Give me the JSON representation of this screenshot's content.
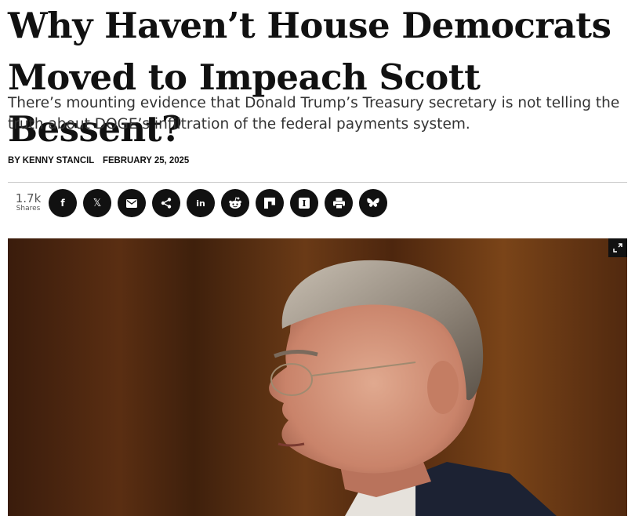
{
  "article": {
    "headline": "Why Haven’t House Democrats Moved to Impeach Scott Bessent?",
    "dek": "There’s mounting evidence that Donald Trump’s Treasury secretary is not telling the truth about DOGE’s infiltration of the federal payments system.",
    "byline": "BY KENNY STANCIL",
    "date": "FEBRUARY 25, 2025"
  },
  "share": {
    "count": "1.7k",
    "count_label": "Shares",
    "buttons": [
      {
        "name": "facebook",
        "icon": "facebook-icon",
        "glyph": "f"
      },
      {
        "name": "x",
        "icon": "x-icon",
        "glyph": "𝕏"
      },
      {
        "name": "email",
        "icon": "email-icon"
      },
      {
        "name": "share",
        "icon": "share-icon"
      },
      {
        "name": "linkedin",
        "icon": "linkedin-icon",
        "glyph": "in"
      },
      {
        "name": "reddit",
        "icon": "reddit-icon"
      },
      {
        "name": "flipboard",
        "icon": "flipboard-icon"
      },
      {
        "name": "instapaper",
        "icon": "instapaper-icon",
        "glyph": "I"
      },
      {
        "name": "print",
        "icon": "print-icon"
      },
      {
        "name": "bluesky",
        "icon": "bluesky-icon"
      }
    ]
  },
  "image": {
    "expand_icon": "expand-icon"
  }
}
